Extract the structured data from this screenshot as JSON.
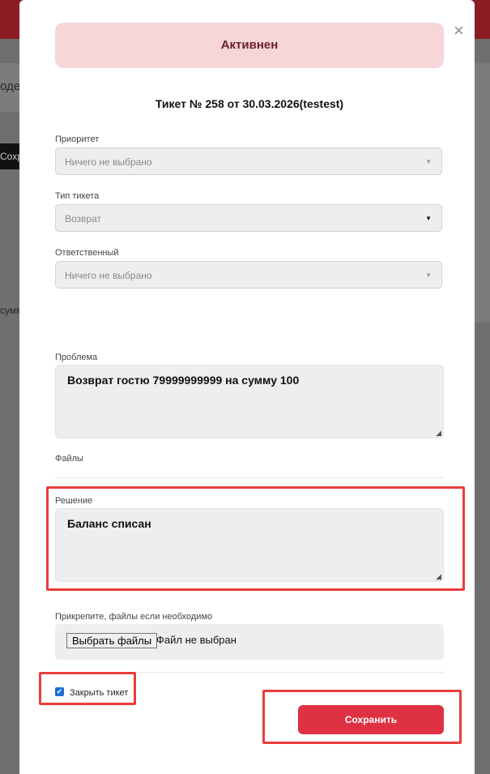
{
  "background": {
    "text_fragment_1": "одер",
    "button_fragment": "Сохра",
    "text_fragment_2": "сумм"
  },
  "modal": {
    "close_glyph": "×",
    "status": "Активнен",
    "ticket_title": "Тикет № 258 от 30.03.2026(testest)",
    "priority": {
      "label": "Приоритет",
      "value": "Ничего не выбрано"
    },
    "ticket_type": {
      "label": "Тип тикета",
      "value": "Возврат"
    },
    "responsible": {
      "label": "Ответственный",
      "value": "Ничего не выбрано"
    },
    "problem": {
      "label": "Проблема",
      "value": "Возврат гостю 79999999999 на сумму 100"
    },
    "files": {
      "label": "Файлы"
    },
    "solution": {
      "label": "Решение",
      "value": "Баланс списан"
    },
    "attach": {
      "label": "Прикрепите, файлы если необходимо",
      "button": "Выбрать файлы",
      "status": "Файл не выбран"
    },
    "close_ticket": {
      "label": "Закрыть тикет",
      "checked": true
    },
    "save_button": "Сохранить"
  },
  "colors": {
    "accent": "#de3242",
    "status_bg": "#f6d6d9",
    "highlight": "#ea3c3c",
    "checkbox": "#1d6fd6"
  }
}
